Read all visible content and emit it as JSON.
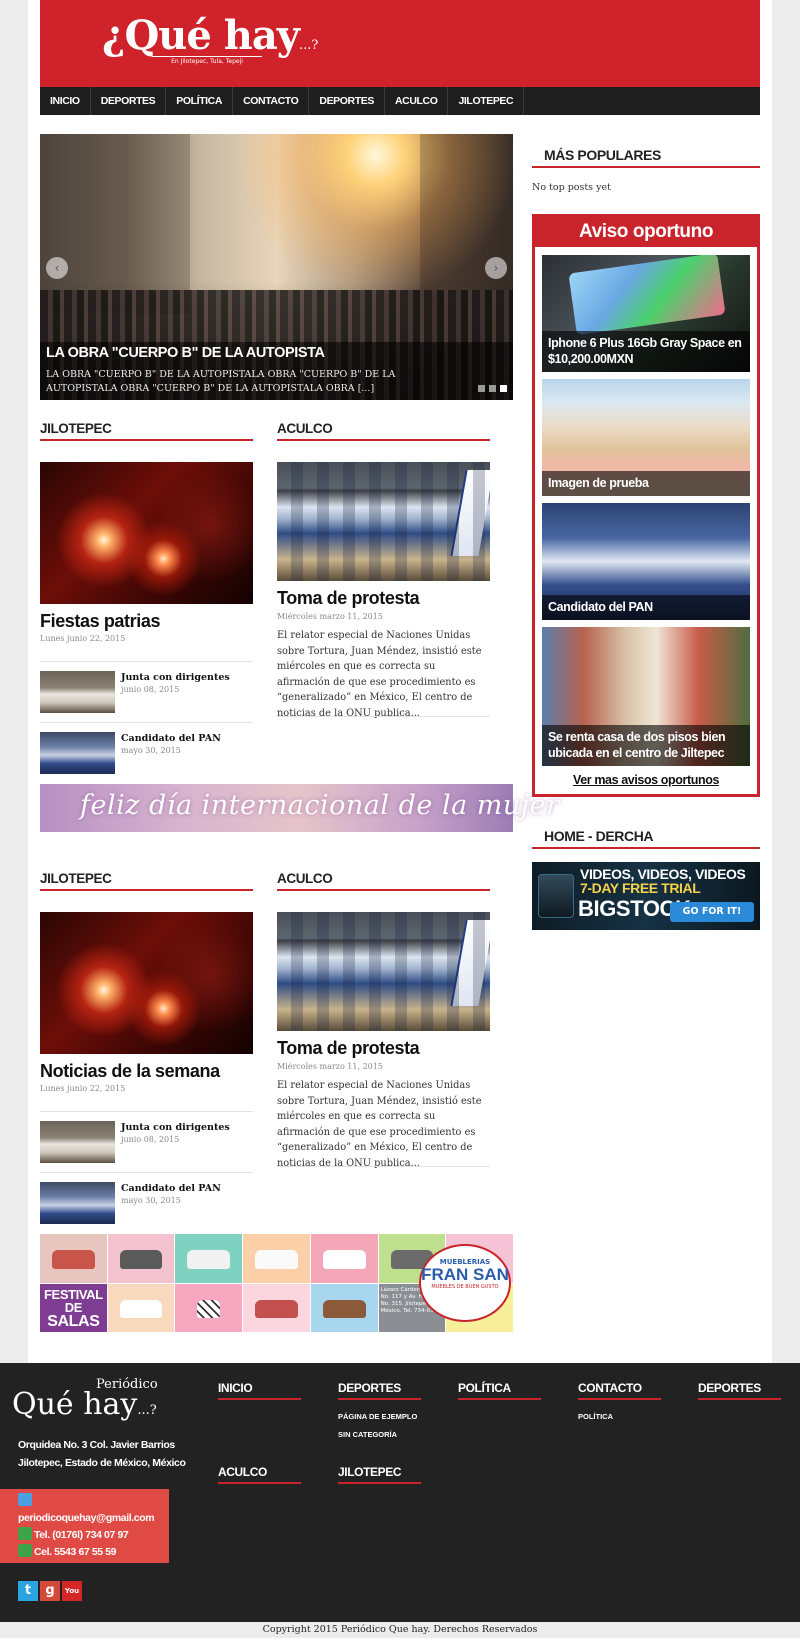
{
  "header": {
    "logo_text": "¿Qué hay",
    "logo_dots": "...?",
    "logo_tagline": "En Jilotepec, Tula, Tepeji"
  },
  "nav": [
    "INICIO",
    "DEPORTES",
    "POLÍTICA",
    "CONTACTO",
    "DEPORTES",
    "ACULCO",
    "JILOTEPEC"
  ],
  "slider": {
    "title": "LA OBRA \"CUERPO B\" DE LA AUTOPISTA",
    "excerpt": "LA OBRA \"CUERPO B\" DE LA AUTOPISTALA OBRA \"CUERPO B\" DE LA AUTOPISTALA OBRA \"CUERPO B\" DE LA AUTOPISTALA OBRA [...]",
    "prev": "‹",
    "next": "›"
  },
  "sections": [
    {
      "left": {
        "heading": "JILOTEPEC",
        "main_title": "Fiestas patrias",
        "main_date": "Lunes junio 22, 2015",
        "small": [
          {
            "title": "Junta con dirigentes",
            "date": "junio 08, 2015"
          },
          {
            "title": "Candidato del PAN",
            "date": "mayo 30, 2015"
          }
        ]
      },
      "right": {
        "heading": "ACULCO",
        "main_title": "Toma de protesta",
        "main_date": "Miércoles marzo 11, 2015",
        "excerpt": "El relator especial de Naciones Unidas sobre Tortura, Juan Méndez, insistió este miércoles en que es correcta su afirmación de que ese procedimiento es “generalizado” en México, El centro de  noticias de la ONU publica..."
      }
    },
    {
      "left": {
        "heading": "JILOTEPEC",
        "main_title": "Noticias de la semana",
        "main_date": "Lunes junio 22, 2015",
        "small": [
          {
            "title": "Junta con dirigentes",
            "date": "junio 08, 2015"
          },
          {
            "title": "Candidato del PAN",
            "date": "mayo 30, 2015"
          }
        ]
      },
      "right": {
        "heading": "ACULCO",
        "main_title": "Toma de protesta",
        "main_date": "Miércoles marzo 11, 2015",
        "excerpt": "El relator especial de Naciones Unidas sobre Tortura, Juan Méndez, insistió este miércoles en que es correcta su afirmación de que ese procedimiento es “generalizado” en México, El centro de  noticias de la ONU publica..."
      }
    }
  ],
  "banner_mujer": "feliz día internacional de la mujer",
  "banner_salas": {
    "festival_line1": "FESTIVAL",
    "festival_line2": "DE",
    "festival_line3": "SALAS",
    "address": "Lázaro Cárdenas Sur No. 117 y Av. Hidalgo No. 315. Jilotepec, México. Tel. 734-03-55",
    "brand_top": "MUEBLERIAS",
    "brand_name": "FRAN SAN",
    "brand_tagline": "MUEBLES DE BUEN GUSTO"
  },
  "sidebar": {
    "popular_heading": "MÁS POPULARES",
    "no_posts": "No top posts yet",
    "aviso_heading": "Aviso oportuno",
    "aviso_items": [
      "Iphone 6 Plus 16Gb Gray Space en $10,200.00MXN",
      "Imagen de prueba",
      "Candidato del PAN",
      "Se renta casa de dos pisos bien ubicada en el centro de Jiltepec"
    ],
    "ver_mas": "Ver mas avisos oportunos",
    "home_heading": "HOME - DERCHA",
    "ad": {
      "line1": "VIDEOS, VIDEOS, VIDEOS",
      "line2": "7-DAY FREE TRIAL",
      "brand": "BIGSTOCK",
      "button": "GO FOR IT!"
    }
  },
  "footer": {
    "logo_periodico": "Periódico",
    "logo_name": "Qué hay",
    "logo_dots": "...?",
    "address_line1": "Orquidea No. 3 Col. Javier Barrios",
    "address_line2": "Jilotepec, Estado de México, México",
    "email": "periodicoquehay@gmail.com",
    "phone1": "Tel. (0176l) 734 07 97",
    "phone2": "Cel. 5543 67 55 59",
    "social": [
      "t",
      "g",
      "You"
    ],
    "columns": [
      {
        "heading": "INICIO",
        "items": []
      },
      {
        "heading": "DEPORTES",
        "items": [
          "PÁGINA DE EJEMPLO",
          "SIN CATEGORÍA"
        ]
      },
      {
        "heading": "POLÍTICA",
        "items": []
      },
      {
        "heading": "CONTACTO",
        "items": [
          "POLÍTICA"
        ]
      },
      {
        "heading": "DEPORTES",
        "items": []
      },
      {
        "heading": "ACULCO",
        "items": []
      },
      {
        "heading": "JILOTEPEC",
        "items": []
      }
    ],
    "copyright": "Copyright 2015 Periódico Que hay. Derechos Reservados"
  },
  "colors": {
    "brand_red": "#d0222a",
    "nav_dark": "#1e1e1e",
    "footer_dark": "#222222",
    "footer_contact_red": "#e04a45"
  }
}
